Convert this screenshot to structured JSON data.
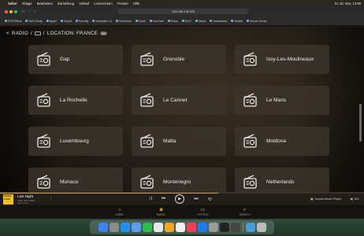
{
  "menubar": {
    "app_name": "Safari",
    "menus": [
      "Ablage",
      "Bearbeiten",
      "Darstellung",
      "Verlauf",
      "Lesezeichen",
      "Fenster",
      "Hilfe"
    ],
    "clock": "Di. 26. Nov. 13:59"
  },
  "browser": {
    "url": "192.168.178.109",
    "bookmarks": [
      "FRITZ!Box",
      "NAS Emaji",
      "Apple",
      "iCloud",
      "Roonity",
      "Dashcam / A",
      "Facebook",
      "Gmail",
      "YouTube",
      "Roon",
      "Wi-Fi",
      "Music",
      "Downloads",
      "Reddit",
      "Innuos Sense"
    ]
  },
  "breadcrumb": {
    "back_label": "<",
    "radio": "RADIO",
    "separator": "/",
    "location": "LOCATION: FRANCE",
    "count": "99"
  },
  "stations": [
    "Gap",
    "Grenoble",
    "Issy-Les-Moulineaux",
    "La Rochelle",
    "Le Cannet",
    "Le Mans",
    "Luxembourg",
    "Malta",
    "Moldova",
    "Monaco",
    "Montenegro",
    "Netherlands"
  ],
  "player": {
    "title": "Last Night",
    "subtitle": "1:56 / 3:17 CSM",
    "subtitle2": "Jean-Yves",
    "thumb_text": "RADIO 2 90S",
    "output": "Innuos Music Player",
    "volume": "100",
    "progress": 0.6
  },
  "nav": [
    {
      "label": "HOME",
      "icon": "home-icon"
    },
    {
      "label": "MUSIC",
      "icon": "music-icon"
    },
    {
      "label": "SYSTEM",
      "icon": "system-icon"
    },
    {
      "label": "SEARCH",
      "icon": "search-icon"
    }
  ],
  "colors": {
    "accent": "#d2a648",
    "card": "#3c342c",
    "background": "#1d1a16"
  }
}
